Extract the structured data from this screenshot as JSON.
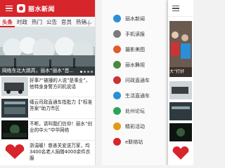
{
  "left": {
    "app_title": "丽水新闻",
    "tabs": [
      "头条",
      "时政",
      "热门",
      "公告",
      "官员",
      "热销"
    ],
    "hero_caption": "网络东北大跳高，丽水“丽水”首...",
    "news": [
      {
        "text": "好事?“被撞的人说”是事业”，他特身身警方问机说话"
      },
      {
        "text": "缙云司政直通车指批力【“标准答案”助力市区"
      },
      {
        "text": "不断，请叫我们信仰！丽水“创业的中火”中华网络"
      },
      {
        "text": "浙温暖！慈善关爱送万家，均3400名老人捐赠4000余件衣服"
      }
    ]
  },
  "right": {
    "drawer": [
      {
        "label": "丽水新闻",
        "color": "#2b8fd8"
      },
      {
        "label": "手机读报",
        "color": "#7a7a7a"
      },
      {
        "label": "摄影美图",
        "color": "#e05a2b"
      },
      {
        "label": "丽水舞视",
        "color": "#4a8a3c"
      },
      {
        "label": "问政直通车",
        "color": "#c33"
      },
      {
        "label": "生活直通车",
        "color": "#2b8fd8"
      },
      {
        "label": "处州论坛",
        "color": "#2aa35b"
      },
      {
        "label": "精彩活动",
        "color": "#e09a18"
      },
      {
        "label": "e联络站",
        "color": "#d6252b"
      }
    ],
    "overlay_captions": [
      "丽水",
      "大”打好"
    ]
  }
}
